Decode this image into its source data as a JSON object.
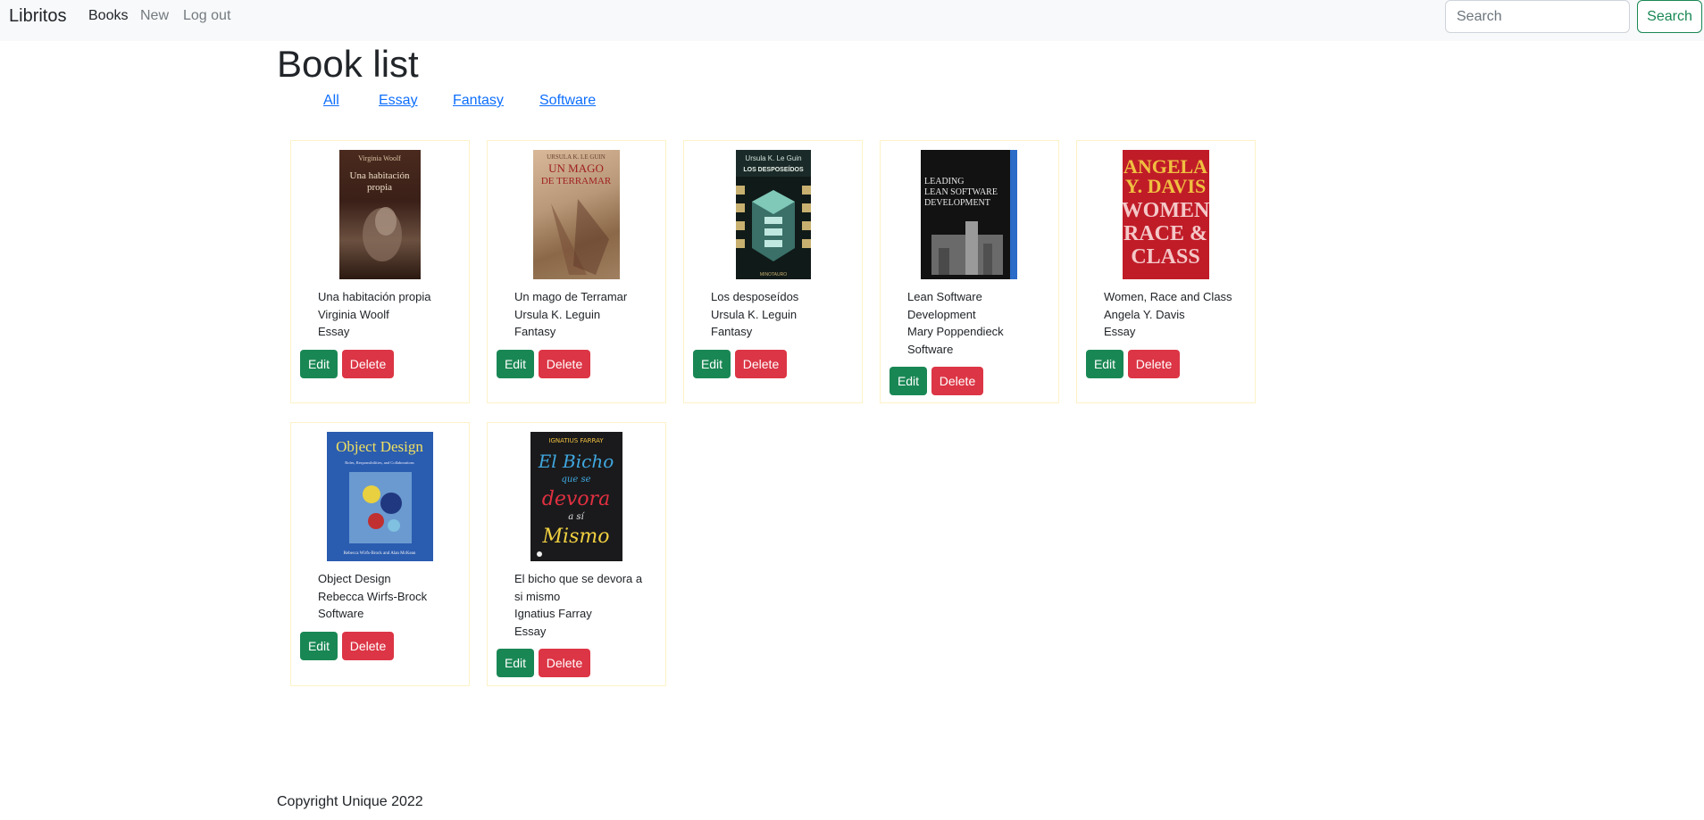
{
  "navbar": {
    "brand": "Libritos",
    "links": [
      "Books",
      "New",
      "Log out"
    ],
    "search_placeholder": "Search",
    "search_button": "Search"
  },
  "page": {
    "title": "Book list",
    "filters": [
      "All",
      "Essay",
      "Fantasy",
      "Software"
    ]
  },
  "books": [
    {
      "title": "Una habitación propia",
      "author": "Virginia Woolf",
      "genre": "Essay",
      "cover_text": [
        "Virginia Woolf",
        "Una habitación",
        "propia"
      ]
    },
    {
      "title": "Un mago de Terramar",
      "author": "Ursula K. Leguin",
      "genre": "Fantasy",
      "cover_text": [
        "URSULA K. LE GUIN",
        "UN MAGO",
        "DE TERRAMAR"
      ]
    },
    {
      "title": "Los desposeídos",
      "author": "Ursula K. Leguin",
      "genre": "Fantasy",
      "cover_text": [
        "Ursula K. Le Guin",
        "LOS DESPOSEÍDOS",
        "MINOTAURO"
      ]
    },
    {
      "title": "Lean Software Development",
      "author": "Mary Poppendieck",
      "genre": "Software",
      "cover_text": [
        "LEADING",
        "LEAN SOFTWARE",
        "DEVELOPMENT"
      ]
    },
    {
      "title": "Women, Race and Class",
      "author": "Angela Y. Davis",
      "genre": "Essay",
      "cover_text": [
        "ANGELA",
        "Y. DAVIS",
        "WOMEN",
        "RACE &",
        "CLASS"
      ]
    },
    {
      "title": "Object Design",
      "author": "Rebecca Wirfs-Brock",
      "genre": "Software",
      "cover_text": [
        "Object Design",
        "Roles, Responsibilities, and Collaborations",
        "Rebecca Wirfs-Brock and Alan McKean"
      ]
    },
    {
      "title": "El bicho que se devora a si mismo",
      "author": "Ignatius Farray",
      "genre": "Essay",
      "cover_text": [
        "IGNATIUS FARRAY",
        "El Bicho",
        "que se",
        "devora",
        "a sí",
        "Mismo"
      ]
    }
  ],
  "buttons": {
    "edit": "Edit",
    "delete": "Delete"
  },
  "footer": "Copyright Unique 2022",
  "colors": {
    "edit": "#198754",
    "delete": "#dc3545",
    "link": "#0d6efd",
    "card_border": "#fdf2c8",
    "navbar_bg": "#f8f9fa"
  }
}
